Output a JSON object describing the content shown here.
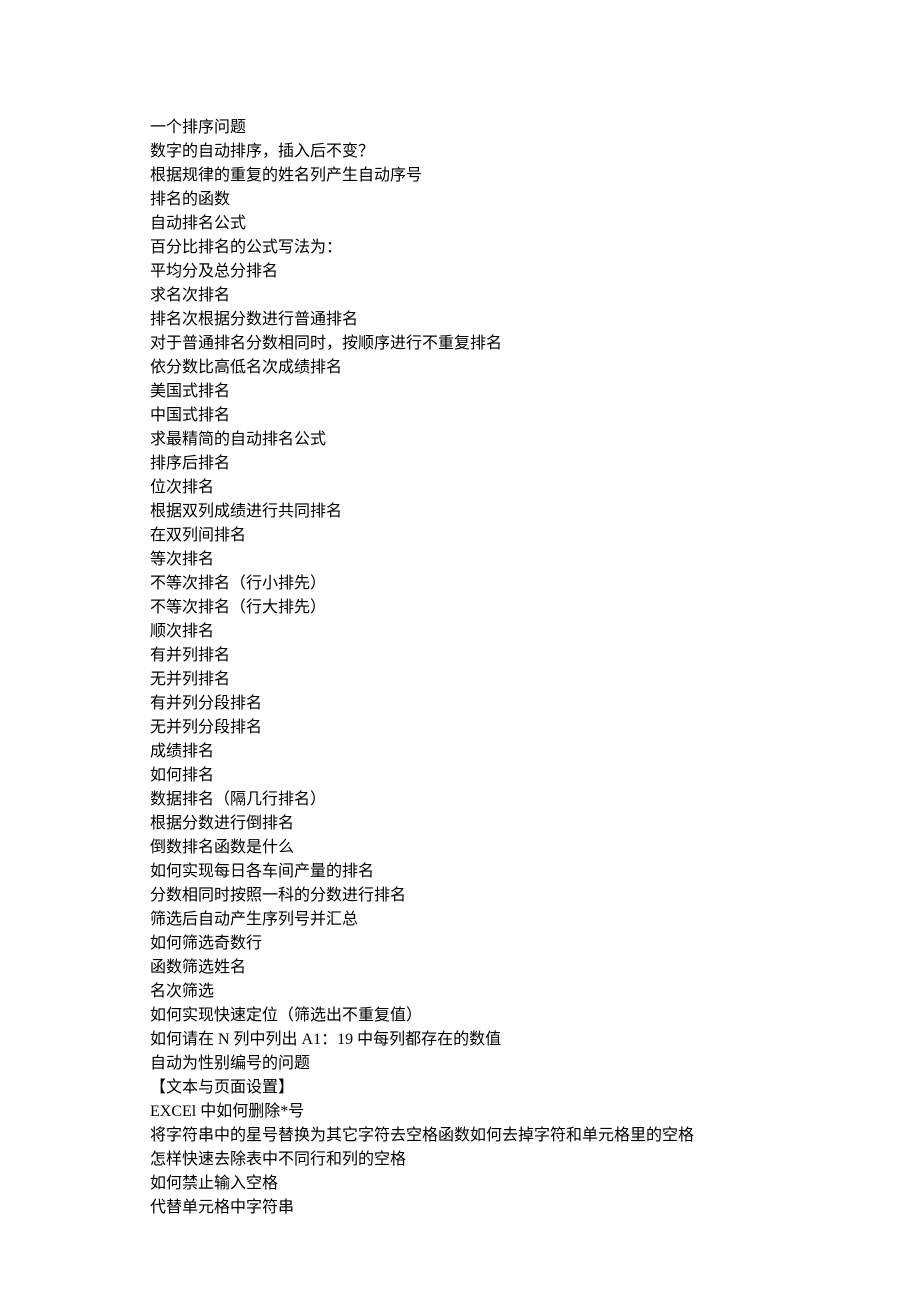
{
  "lines": [
    "一个排序问题",
    "数字的自动排序，插入后不变？",
    "根据规律的重复的姓名列产生自动序号",
    "排名的函数",
    "自动排名公式",
    "百分比排名的公式写法为：",
    "平均分及总分排名",
    "求名次排名",
    "排名次根据分数进行普通排名",
    "对于普通排名分数相同时，按顺序进行不重复排名",
    "依分数比高低名次成绩排名",
    "美国式排名",
    "中国式排名",
    "求最精简的自动排名公式",
    "排序后排名",
    "位次排名",
    "根据双列成绩进行共同排名",
    "在双列间排名",
    "等次排名",
    "不等次排名（行小排先）",
    "不等次排名（行大排先）",
    "顺次排名",
    "有并列排名",
    "无并列排名",
    "有并列分段排名",
    "无并列分段排名",
    "成绩排名",
    "如何排名",
    "数据排名（隔几行排名）",
    "根据分数进行倒排名",
    "倒数排名函数是什么",
    "如何实现每日各车间产量的排名",
    "分数相同时按照一科的分数进行排名",
    "筛选后自动产生序列号并汇总",
    "如何筛选奇数行",
    "函数筛选姓名",
    "名次筛选",
    "如何实现快速定位（筛选出不重复值）",
    "如何请在 N 列中列出 A1：19 中每列都存在的数值",
    "自动为性别编号的问题",
    "【文本与页面设置】",
    "EXCEl 中如何删除*号",
    "将字符串中的星号替换为其它字符去空格函数如何去掉字符和单元格里的空格",
    "怎样快速去除表中不同行和列的空格",
    "如何禁止输入空格",
    "代替单元格中字符串"
  ]
}
